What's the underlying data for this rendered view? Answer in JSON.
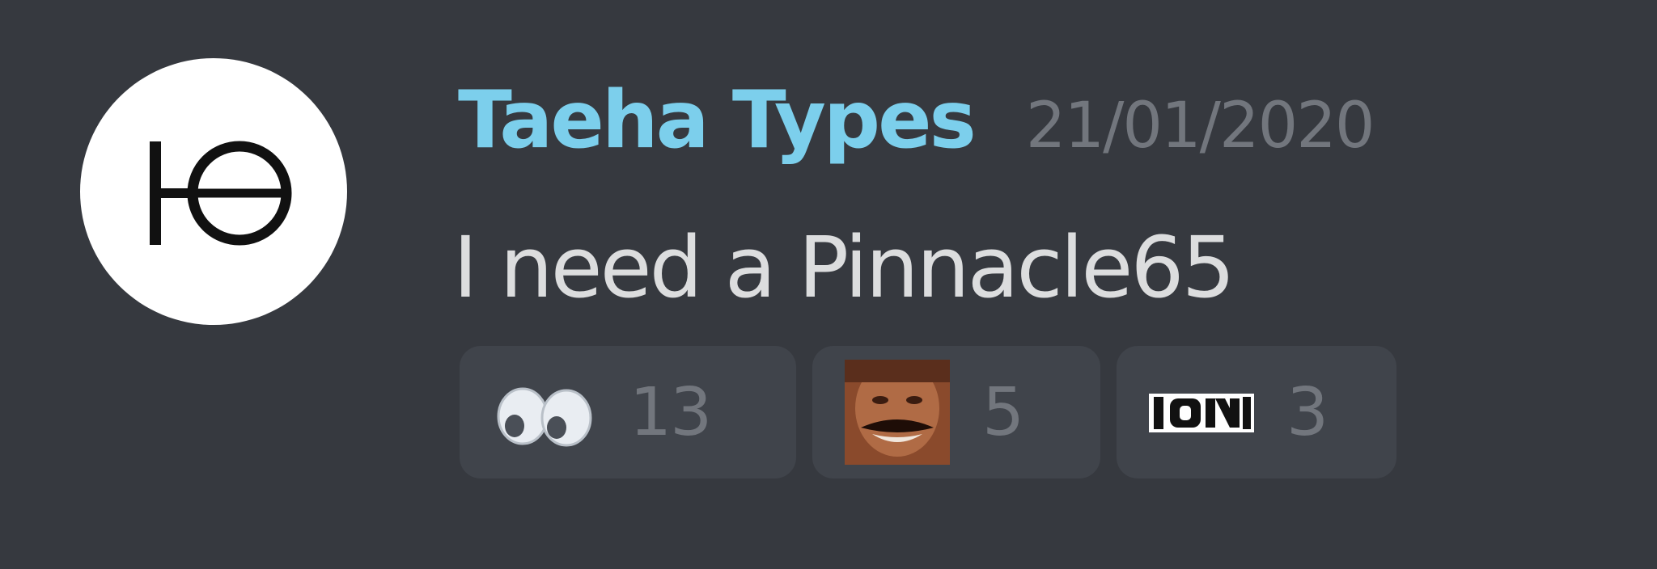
{
  "message": {
    "author": {
      "username": "Taeha Types",
      "username_color": "#7ccfec",
      "avatar_icon": "taeha-types-logo-icon"
    },
    "timestamp": "21/01/2020",
    "content": "I need a Pinnacle65",
    "reactions": [
      {
        "emoji": "eyes-emoji",
        "count": "13"
      },
      {
        "emoji": "risitas-emoji",
        "count": "5"
      },
      {
        "emoji": "on-sign-emoji",
        "count": "3"
      }
    ]
  },
  "colors": {
    "background": "#36393f",
    "reaction_background": "#40444b",
    "text": "#dcddde",
    "muted": "#72767d"
  }
}
